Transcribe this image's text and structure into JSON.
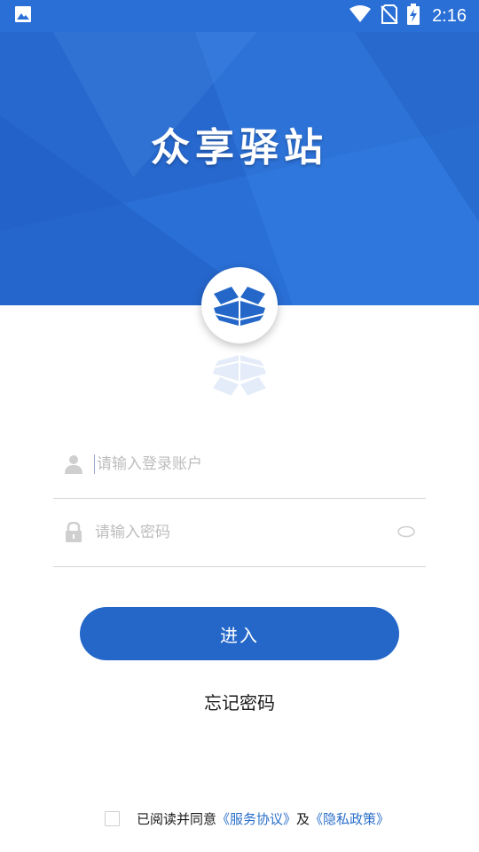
{
  "status_bar": {
    "time": "2:16",
    "icons": [
      "image-icon",
      "wifi-icon",
      "no-sim-icon",
      "battery-charging-icon"
    ]
  },
  "header": {
    "title": "众享驿站",
    "background_color": "#2a6fd6"
  },
  "login": {
    "account_placeholder": "请输入登录账户",
    "password_placeholder": "请输入密码",
    "enter_label": "进入",
    "forgot_label": "忘记密码"
  },
  "agreement": {
    "prefix": "已阅读并同意",
    "service_link": "《服务协议》",
    "and": "及",
    "privacy_link": "《隐私政策》",
    "checked": false
  },
  "colors": {
    "primary": "#2467c9",
    "link": "#2b6fc9",
    "placeholder": "#bdbdbd"
  }
}
